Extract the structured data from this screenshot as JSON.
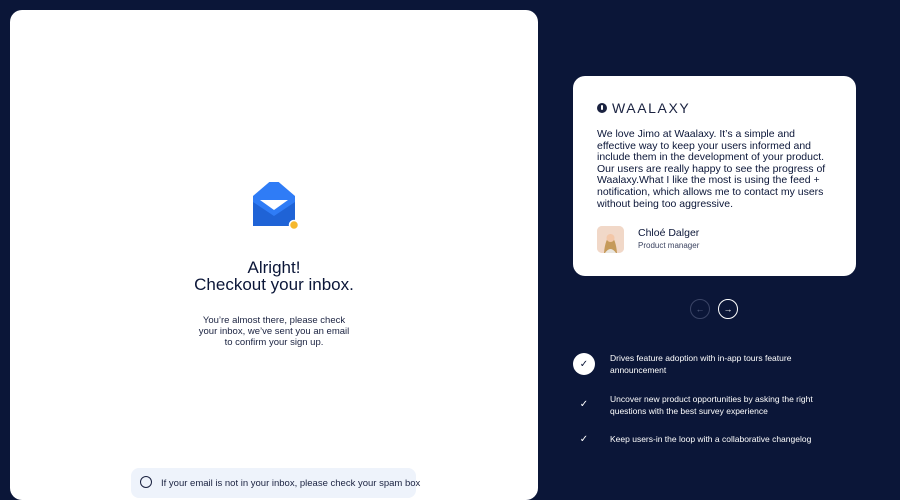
{
  "signup": {
    "title_line1": "Alright!",
    "title_line2": "Checkout your inbox.",
    "subtitle": "You’re almost there, please check your inbox, we’ve sent you an email to confirm your sign up.",
    "spam_note": "If your email is not in your inbox, please check your spam box",
    "icons": {
      "mail": "envelope-icon",
      "info": "info-icon"
    },
    "colors": {
      "accent": "#2f7cf6",
      "badge": "#f5b82e",
      "ink": "#0b1638"
    }
  },
  "testimonial": {
    "brand": "WAALAXY",
    "quote": "We love Jimo at Waalaxy. It’s a simple and effective way to keep your users informed and include them in the development of your product. Our users are really happy to see the progress of Waalaxy.What I like the most is using the feed + notification, which allows me to contact my users without being too aggressive.",
    "author_name": "Chloé Dalger",
    "author_role": "Product manager"
  },
  "carousel": {
    "prev_icon": "arrow-left-icon",
    "next_icon": "arrow-right-icon"
  },
  "features": [
    {
      "text": "Drives feature adoption with in-app tours feature announcement",
      "active": true
    },
    {
      "text": "Uncover new product opportunities by asking the right questions with the best survey experience",
      "active": false
    },
    {
      "text": "Keep users-in the loop with a collaborative changelog",
      "active": false
    }
  ],
  "theme": {
    "background": "#0b1638"
  }
}
